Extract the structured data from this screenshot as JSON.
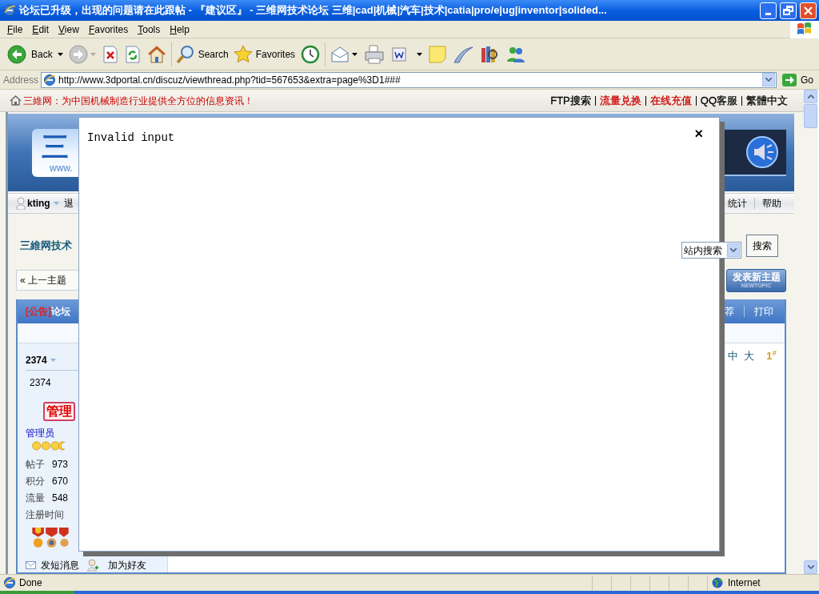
{
  "window": {
    "title": "论坛已升级，出现的问题请在此跟帖 - 『建议区』 - 三维网技术论坛 三维|cad|机械|汽车|技术|catia|pro/e|ug|inventor|solided..."
  },
  "menu": [
    "File",
    "Edit",
    "View",
    "Favorites",
    "Tools",
    "Help"
  ],
  "toolbar": {
    "back": "Back",
    "search": "Search",
    "favorites": "Favorites"
  },
  "address": {
    "label": "Address",
    "url": "http://www.3dportal.cn/discuz/viewthread.php?tid=567653&extra=page%3D1###",
    "go": "Go"
  },
  "page": {
    "slogan": "三維网：为中国机械制造行业提供全方位的信息资讯！",
    "top_links": [
      {
        "text": "FTP搜索",
        "color": "#000000"
      },
      {
        "text": "流量兑换",
        "color": "#cc0000"
      },
      {
        "text": "在线充值",
        "color": "#cc0000"
      },
      {
        "text": "QQ客服",
        "color": "#000000"
      },
      {
        "text": "繁體中文",
        "color": "#000000"
      }
    ],
    "logo": {
      "mark": "三",
      "site": "www."
    },
    "user": {
      "name": "kting",
      "logout": "退"
    },
    "nav_right": [
      "统计",
      "帮助"
    ],
    "breadcrumb": "三維网技术",
    "search": {
      "scope": "站内搜索",
      "button": "搜索"
    },
    "prev_topic": "« 上一主题",
    "new_topic": {
      "label": "发表新主题",
      "sub": "NEWTOPIC"
    },
    "thread": {
      "tag": "[公告]",
      "title": "论坛",
      "actions": [
        "荐",
        "打印"
      ]
    },
    "post": {
      "author": "2374",
      "author_id": "2374",
      "badge": "管理",
      "group": "管理员",
      "stats": [
        {
          "label": "帖子",
          "value": "973"
        },
        {
          "label": "积分",
          "value": "670"
        },
        {
          "label": "流量",
          "value": "548"
        }
      ],
      "registered_label": "注册时间",
      "actions": [
        "发短消息",
        "加为好友"
      ],
      "font_sizes": [
        "中",
        "大"
      ],
      "floor": "1$^{#}$"
    }
  },
  "dialog": {
    "message": "Invalid input",
    "close": "×"
  },
  "status_bar": {
    "text": "Done",
    "zone": "Internet"
  }
}
